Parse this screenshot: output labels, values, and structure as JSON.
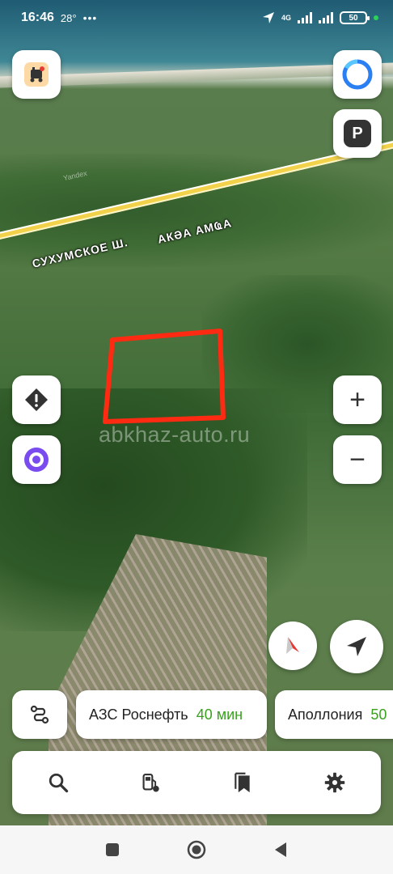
{
  "status_bar": {
    "time": "16:46",
    "temperature": "28°",
    "more": "•••",
    "network": "4G",
    "battery": "50"
  },
  "map": {
    "road_label_ru": "СУХУМСКОЕ Ш.",
    "road_label_abkhaz": "АКӘА АМҨА",
    "watermark": "abkhaz-auto.ru",
    "provider_label": "Yandex",
    "plot_outline_color": "#ff2a12"
  },
  "icons": {
    "traffic": "traffic-camera-icon",
    "alice": "alice-assistant-icon",
    "parking": "parking-icon",
    "warning": "road-warning-icon",
    "zoom_in": "plus-icon",
    "zoom_out": "minus-icon",
    "compass": "compass-icon",
    "location": "navigation-arrow-icon",
    "route": "route-icon",
    "search": "search-icon",
    "fuel": "fuel-station-icon",
    "bookmarks": "bookmark-icon",
    "settings": "gear-icon"
  },
  "buttons": {
    "parking_label": "P",
    "zoom_in_label": "+",
    "zoom_out_label": "−"
  },
  "suggestions": [
    {
      "name": "АЗС Роснефть",
      "eta": "40 мин"
    },
    {
      "name": "Аполлония",
      "eta": "50"
    }
  ],
  "colors": {
    "accent_blue": "#2a7ff2",
    "alice_purple": "#7a4cf0",
    "eta_green": "#3aa11f"
  }
}
